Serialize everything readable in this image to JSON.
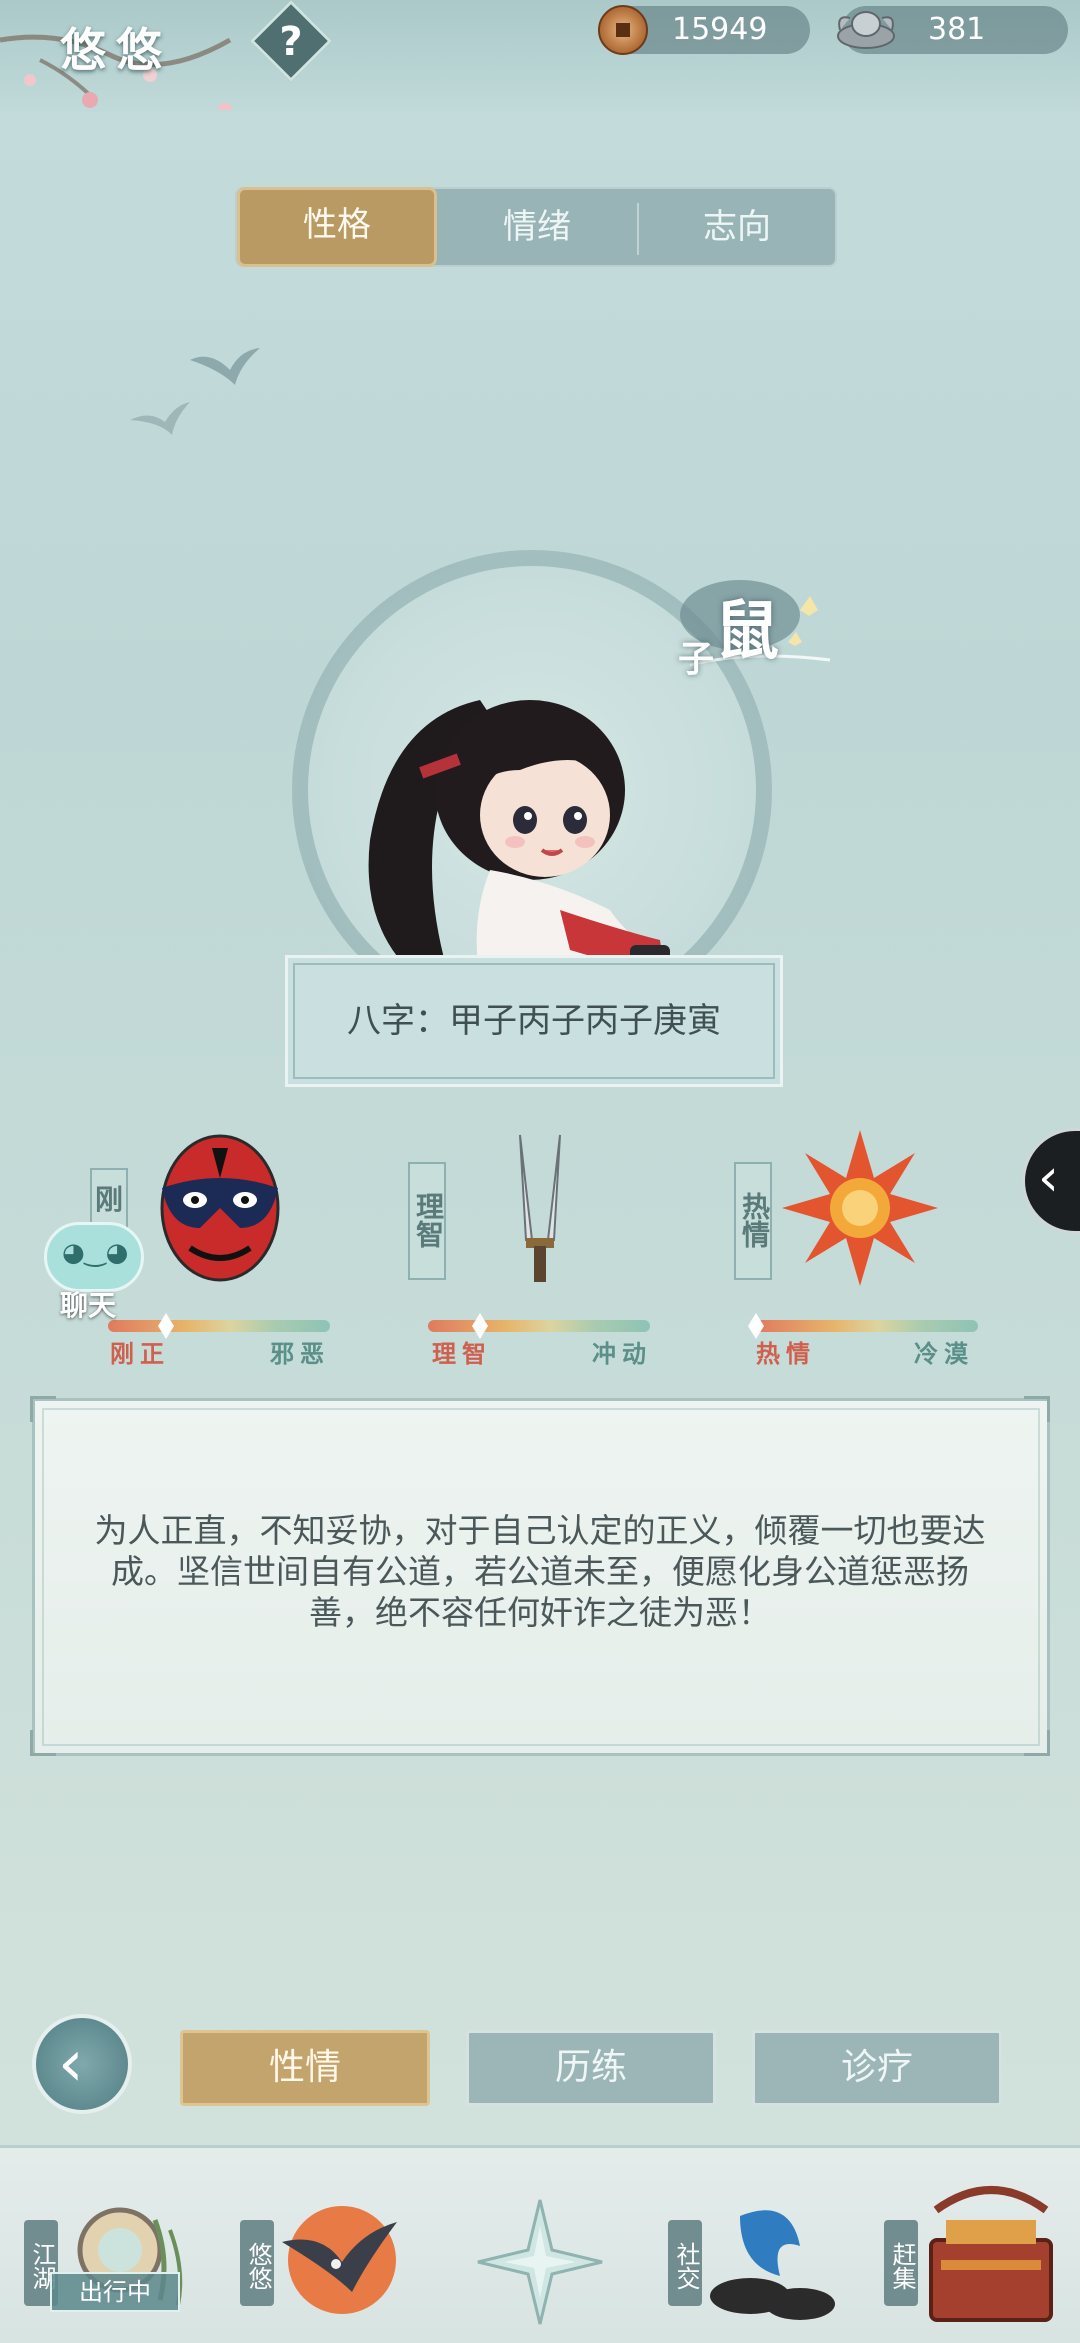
{
  "player": {
    "name": "悠悠",
    "help_icon": "?"
  },
  "currency": {
    "copper": "15949",
    "silver": "381"
  },
  "tabs": [
    {
      "label": "性格",
      "active": true
    },
    {
      "label": "情绪",
      "active": false
    },
    {
      "label": "志向",
      "active": false
    }
  ],
  "zodiac": {
    "main": "鼠",
    "sub": "子"
  },
  "bazi": "八字：甲子丙子丙子庚寅",
  "traits": [
    {
      "tag": "刚",
      "left": "刚正",
      "right": "邪恶",
      "icon": "opera-mask-icon",
      "value": 0.27
    },
    {
      "tag": "理智",
      "left": "理智",
      "right": "冲动",
      "icon": "twin-swords-icon",
      "value": 0.22
    },
    {
      "tag": "热情",
      "left": "热情",
      "right": "冷漠",
      "icon": "sun-flame-icon",
      "value": 0.0
    }
  ],
  "chat": {
    "label": "聊天"
  },
  "description": "为人正直，不知妥协，对于自己认定的正义，倾覆一切也要达成。坚信世间自有公道，若公道未至，便愿化身公道惩恶扬善，绝不容任何奸诈之徒为恶！",
  "sub_tabs": [
    {
      "label": "性情",
      "active": true
    },
    {
      "label": "历练",
      "active": false
    },
    {
      "label": "诊疗",
      "active": false
    }
  ],
  "bottom_nav": [
    {
      "label": "江湖",
      "status": "出行中"
    },
    {
      "label": "悠悠"
    },
    {
      "label": ""
    },
    {
      "label": "社交"
    },
    {
      "label": "赶集"
    }
  ],
  "colors": {
    "accent_gold": "#b99a63",
    "panel_teal": "#9cb6b8",
    "background": "#c4dcdc"
  }
}
